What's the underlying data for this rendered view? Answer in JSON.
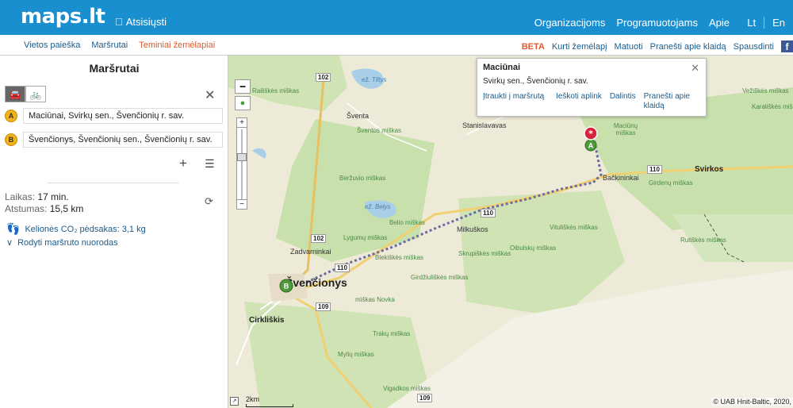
{
  "header": {
    "logo": "maps.lt",
    "download_label": "Atsisiųsti",
    "apple_icon": "apple-icon",
    "nav": [
      "Organizacijoms",
      "Programuotojams",
      "Apie"
    ],
    "languages": [
      "Lt",
      "En"
    ]
  },
  "subbar": {
    "tabs": [
      "Vietos paieška",
      "Maršrutai",
      "Teminiai žemėlapiai"
    ],
    "beta": "BETA",
    "links": [
      "Kurti žemėlapį",
      "Matuoti",
      "Pranešti apie klaidą",
      "Spausdinti"
    ]
  },
  "panel": {
    "title": "Maršrutai",
    "waypoint_a": {
      "marker": "A",
      "value": "Maciūnai, Svirkų sen., Švenčionių r. sav."
    },
    "waypoint_b": {
      "marker": "B",
      "value": "Švenčionys, Švenčionių sen., Švenčionių r. sav."
    },
    "time_label": "Laikas:",
    "time_value": "17 min.",
    "distance_label": "Atstumas:",
    "distance_value": "15,5 km",
    "co2_text": "Kelionės CO₂ pėdsakas: 3,1 kg",
    "directions_text": "Rodyti maršruto nuorodas"
  },
  "popup": {
    "title": "Maciūnai",
    "address": "Svirkų sen., Švenčionių r. sav.",
    "links": [
      "Įtraukti į maršrutą",
      "Ieškoti aplink",
      "Dalintis",
      "Pranešti apie klaidą"
    ]
  },
  "map": {
    "towns": [
      "Švenčionys",
      "Cirkliškis",
      "Zadvarninkai",
      "Milkuškos",
      "Bačkininkai",
      "Svirkos",
      "Stanislavavas",
      "Šventa",
      "Maciūnų miškas"
    ],
    "roads": [
      "102",
      "102",
      "110",
      "110",
      "110",
      "109",
      "109"
    ],
    "lakes": [
      "ež. Tiltys",
      "ež. Belys"
    ],
    "forests": [
      "Railiškės miškas",
      "Šventos miškas",
      "Beržuvio miškas",
      "Belio miškas",
      "Lygumų miškas",
      "Blekiškės miškas",
      "Girdžiuliškės miškas",
      "Skrupiškės miškas",
      "Oibulskų miškas",
      "Vituliškės miškas",
      "Girdenų miškas",
      "Rutiškės miškas",
      "miškas Novka",
      "Trakų miškas",
      "Mylių miškas",
      "Vigadkos miškas",
      "Vežiškės miškas",
      "Karališkės miškas"
    ],
    "scale_label": "2km",
    "copyright": "© UAB Hnit-Baltic, 2020,",
    "marker_a": "A",
    "marker_b": "B",
    "route_color": "#6a6aa8",
    "accent": "#1a8fd0"
  }
}
